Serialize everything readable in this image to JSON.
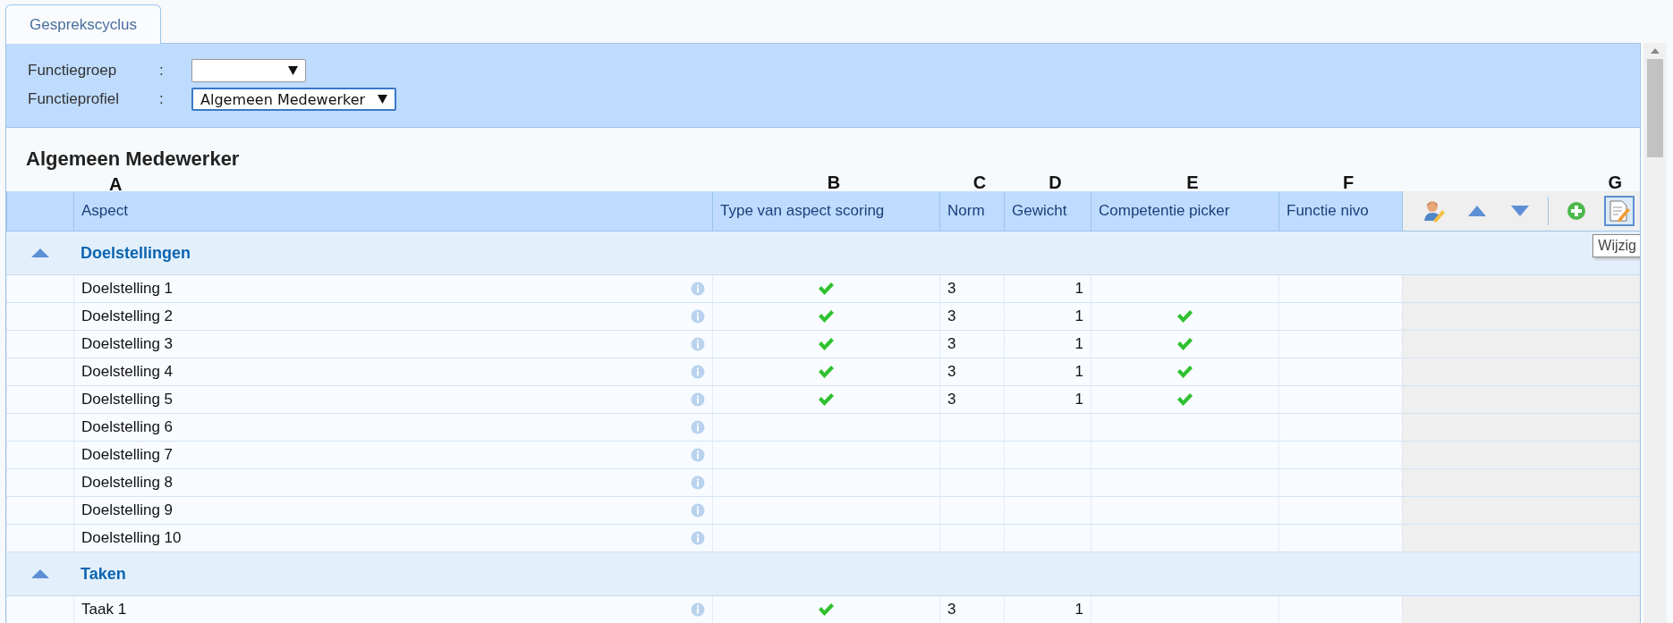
{
  "tab": {
    "label": "Gesprekscyclus",
    "selected": true
  },
  "filters": [
    {
      "label": "Functiegroep",
      "separator": ":",
      "focused": false
    },
    {
      "label": "Functieprofiel",
      "separator": ":",
      "value": "Algemeen Medewerker",
      "focused": true
    }
  ],
  "title": "Algemeen Medewerker",
  "columns": [
    {
      "marker": "A",
      "label": "Aspect"
    },
    {
      "marker": "B",
      "label": "Type van aspect scoring"
    },
    {
      "marker": "C",
      "label": "Norm"
    },
    {
      "marker": "D",
      "label": "Gewicht"
    },
    {
      "marker": "E",
      "label": "Competentie picker"
    },
    {
      "marker": "F",
      "label": "Functie nivo"
    }
  ],
  "toolbar": {
    "marker": "G",
    "tooltip": "Wijzig",
    "buttons": [
      {
        "kind": "person",
        "selected": false
      },
      {
        "kind": "up",
        "selected": false
      },
      {
        "kind": "down",
        "selected": false
      },
      {
        "kind": "divider",
        "selected": false
      },
      {
        "kind": "add",
        "selected": false
      },
      {
        "kind": "edit",
        "selected": true
      }
    ]
  },
  "groups": [
    {
      "name": "Doelstellingen",
      "expanded": true,
      "rows": [
        {
          "aspect": "Doelstelling 1",
          "scoring": true,
          "norm": "3",
          "weight": "1",
          "picker": false
        },
        {
          "aspect": "Doelstelling 2",
          "scoring": true,
          "norm": "3",
          "weight": "1",
          "picker": true
        },
        {
          "aspect": "Doelstelling 3",
          "scoring": true,
          "norm": "3",
          "weight": "1",
          "picker": true
        },
        {
          "aspect": "Doelstelling 4",
          "scoring": true,
          "norm": "3",
          "weight": "1",
          "picker": true
        },
        {
          "aspect": "Doelstelling 5",
          "scoring": true,
          "norm": "3",
          "weight": "1",
          "picker": true
        },
        {
          "aspect": "Doelstelling 6",
          "scoring": false,
          "picker": false
        },
        {
          "aspect": "Doelstelling 7",
          "scoring": false,
          "picker": false
        },
        {
          "aspect": "Doelstelling 8",
          "scoring": false,
          "picker": false
        },
        {
          "aspect": "Doelstelling 9",
          "scoring": false,
          "picker": false
        },
        {
          "aspect": "Doelstelling 10",
          "scoring": false,
          "picker": false
        }
      ]
    },
    {
      "name": "Taken",
      "expanded": true,
      "rows": [
        {
          "aspect": "Taak 1",
          "scoring": true,
          "norm": "3",
          "weight": "1",
          "picker": false
        }
      ]
    }
  ]
}
